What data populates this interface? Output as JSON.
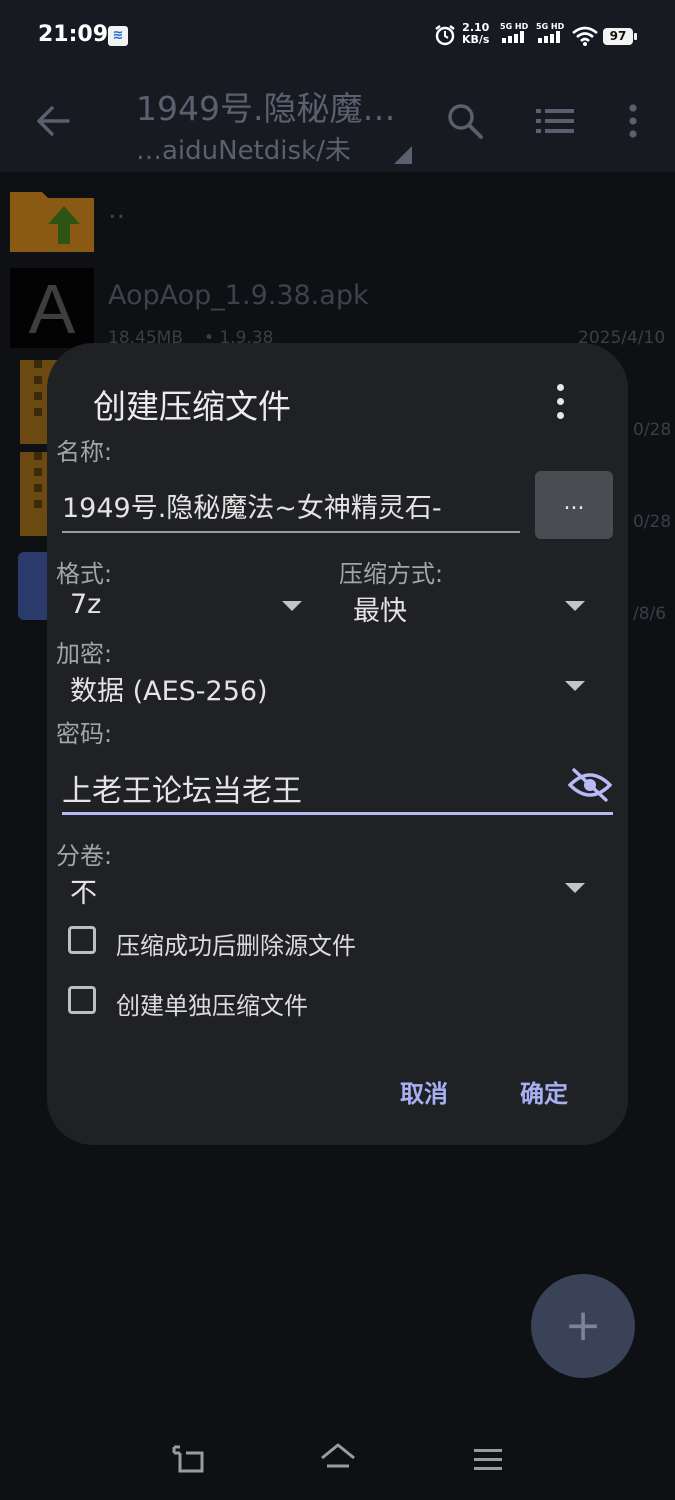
{
  "status_bar": {
    "time": "21:09",
    "speed_value": "2.10",
    "speed_unit": "KB/s",
    "sim1_label": "5G HD",
    "sim2_label": "5G HD",
    "battery": "97"
  },
  "toolbar": {
    "title": "1949号.隐秘魔…",
    "path": "…aiduNetdisk/未"
  },
  "file_list": [
    {
      "name": "..",
      "icon": "folder-up-icon"
    },
    {
      "name": "AopAop_1.9.38.apk",
      "size": "18.45MB",
      "version": "• 1.9.38",
      "date": "2025/4/10",
      "icon": "apk-icon"
    },
    {
      "date": "0/28",
      "icon": "7z-archive-icon"
    },
    {
      "date": "0/28",
      "icon": "zip-archive-icon"
    },
    {
      "date": "/8/6",
      "icon": "app-icon"
    }
  ],
  "dialog": {
    "title": "创建压缩文件",
    "name_label": "名称:",
    "name_value": "1949号.隐秘魔法~女神精灵石-",
    "browse_label": "...",
    "format_label": "格式:",
    "format_value": "7z",
    "method_label": "压缩方式:",
    "method_value": "最快",
    "encryption_label": "加密:",
    "encryption_value": "数据 (AES-256)",
    "password_label": "密码:",
    "password_value": "上老王论坛当老王",
    "split_label": "分卷:",
    "split_value": "不",
    "delete_source_label": "压缩成功后删除源文件",
    "separate_archives_label": "创建单独压缩文件",
    "cancel_label": "取消",
    "ok_label": "确定"
  },
  "fab": {
    "label": "+"
  },
  "colors": {
    "accent": "#b7baf4",
    "button_text": "#a6b0f2",
    "dialog_bg": "#202125",
    "page_bg": "#0e1014"
  }
}
